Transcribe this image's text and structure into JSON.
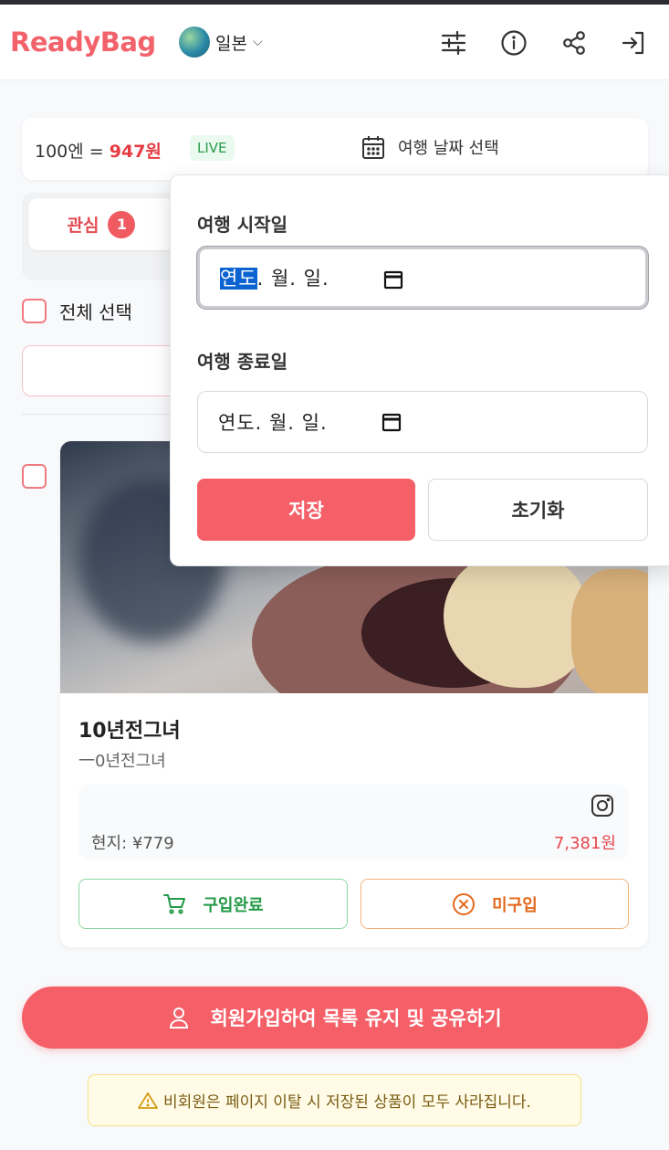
{
  "header": {
    "brand": "ReadyBag",
    "country": "일본",
    "icons": [
      "sliders-icon",
      "info-icon",
      "share-icon",
      "login-icon"
    ]
  },
  "rate": {
    "prefix": "100엔 = ",
    "value": "947원",
    "live": "LIVE",
    "date_button": "여행 날짜 선택"
  },
  "tabs": {
    "favorites": "관심",
    "favorites_count": "1"
  },
  "select_all": "전체 선택",
  "item": {
    "title": "10년전그녀",
    "subtitle": "一0년전그녀",
    "local_price": "현지: ¥779",
    "krw_price": "7,381원",
    "purchased_label": "구입완료",
    "not_purchased_label": "미구입"
  },
  "signup": "회원가입하여 목록 유지 및 공유하기",
  "warning": "비회원은 페이지 이탈 시 저장된 상품이 모두 사라집니다.",
  "date_popup": {
    "start_label": "여행 시작일",
    "end_label": "여행 종료일",
    "start_year": "연도",
    "start_rest": ". 월. 일.",
    "end_value": "연도. 월. 일.",
    "save": "저장",
    "reset": "초기화"
  },
  "colors": {
    "brand": "#f2626b",
    "accent": "#f55f68",
    "green": "#229a45",
    "orange": "#e4681b"
  }
}
